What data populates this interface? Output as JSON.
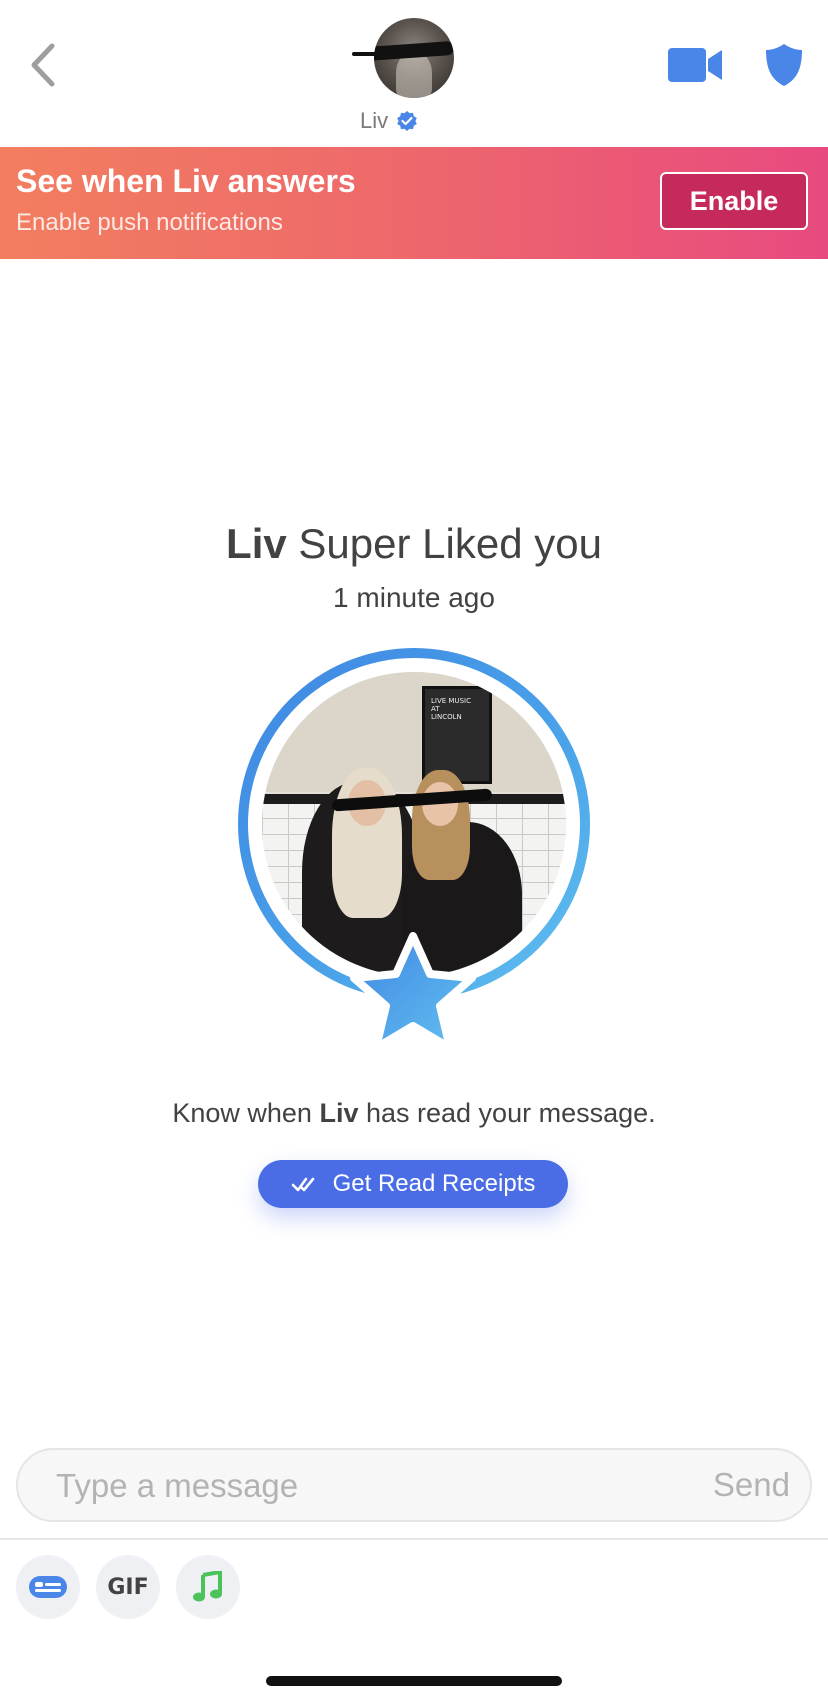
{
  "header": {
    "name": "Liv",
    "back_icon": "chevron-left-icon",
    "verified_icon": "verified-badge-icon",
    "video_icon": "video-camera-icon",
    "shield_icon": "shield-icon"
  },
  "banner": {
    "title": "See when Liv answers",
    "subtitle": "Enable push notifications",
    "button_label": "Enable"
  },
  "super_like": {
    "name": "Liv",
    "action_text": "Super Liked you",
    "time": "1 minute ago",
    "star_icon": "star-icon",
    "photo_text": "LIVE MUSIC AT LINCOLN"
  },
  "read_receipts": {
    "prefix": "Know when",
    "name": "Liv",
    "suffix": "has read your message.",
    "button_label": "Get Read Receipts",
    "button_icon": "double-check-icon"
  },
  "composer": {
    "placeholder": "Type a message",
    "send_label": "Send"
  },
  "toolbar": {
    "gif_label": "GIF",
    "items": [
      "contact-card-icon",
      "gif-icon",
      "music-note-icon"
    ]
  },
  "colors": {
    "accent_blue": "#4a6de5",
    "header_icon_blue": "#4a86e8",
    "banner_start": "#f27e5f",
    "banner_end": "#e84a7f",
    "enable_button": "#c62a5a",
    "music_green": "#4cc25b"
  }
}
